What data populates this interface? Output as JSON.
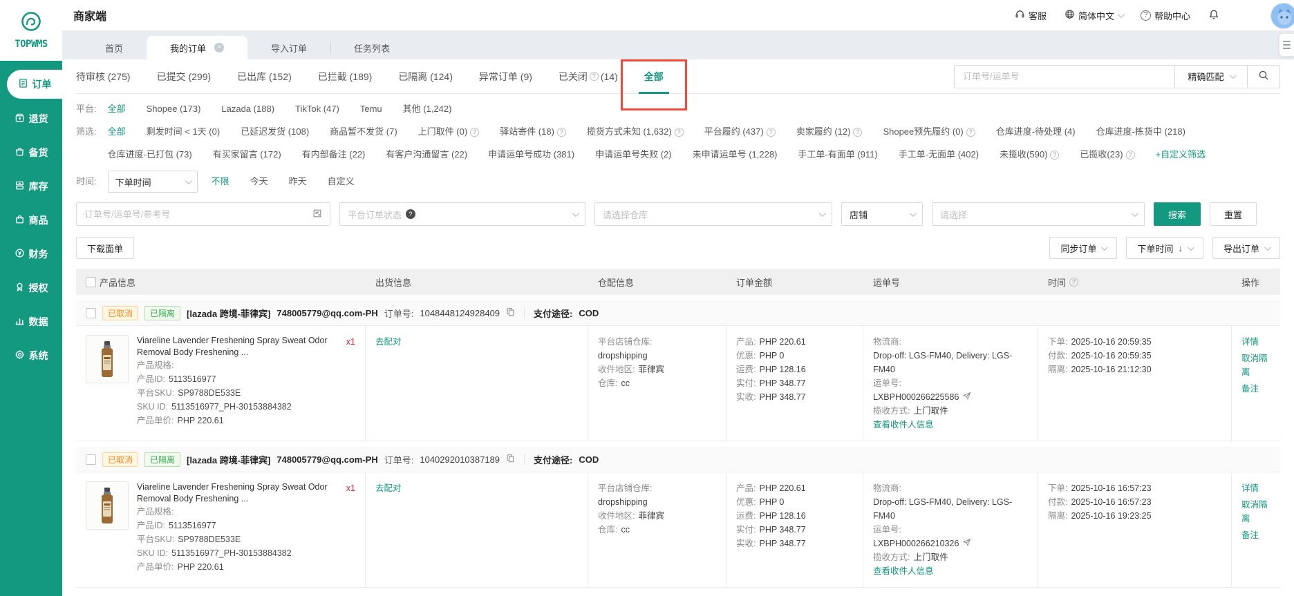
{
  "colors": {
    "accent": "#12997f",
    "annotation_red": "#f5483b",
    "cancel_badge_text": "#fa8c16",
    "quarantine_badge_text": "#3fae51"
  },
  "sidebar": {
    "logo_text": "TOPWMS",
    "items": [
      {
        "label": "订单",
        "active": true
      },
      {
        "label": "退货"
      },
      {
        "label": "备货"
      },
      {
        "label": "库存"
      },
      {
        "label": "商品"
      },
      {
        "label": "财务"
      },
      {
        "label": "授权"
      },
      {
        "label": "数据"
      },
      {
        "label": "系统"
      }
    ]
  },
  "topbar": {
    "title": "商家端",
    "customer_service": "客服",
    "language": "简体中文",
    "help_center": "帮助中心"
  },
  "tabs": {
    "home": "首页",
    "my_orders": "我的订单",
    "import_orders": "导入订单",
    "task_list": "任务列表"
  },
  "status_tabs": [
    {
      "t": "待审核 (275)"
    },
    {
      "t": "已提交 (299)"
    },
    {
      "t": "已出库 (152)"
    },
    {
      "t": "已拦截 (189)"
    },
    {
      "t": "已隔离 (124)"
    },
    {
      "t": "异常订单 (9)"
    },
    {
      "t": "已关闭",
      "help": true,
      "t2": "(14)"
    },
    {
      "t": "全部",
      "active": true,
      "boxed": true
    }
  ],
  "quick_search": {
    "placeholder": "订单号/运单号",
    "match_mode": "精确匹配"
  },
  "filters": {
    "platform_label": "平台:",
    "platform": [
      {
        "t": "全部",
        "active": true
      },
      {
        "t": "Shopee (173)"
      },
      {
        "t": "Lazada (188)"
      },
      {
        "t": "TikTok (47)"
      },
      {
        "t": "Temu"
      },
      {
        "t": "其他 (1,242)"
      }
    ],
    "screen_label": "筛选:",
    "screen_row1": [
      {
        "t": "全部",
        "active": true
      },
      {
        "t": "剩发时间 < 1天 (0)"
      },
      {
        "t": "已延迟发货 (108)"
      },
      {
        "t": "商品暂不发货 (7)"
      },
      {
        "t": "上门取件 (0)",
        "help": true
      },
      {
        "t": "驿站寄件 (18)",
        "help": true
      },
      {
        "t": "揽货方式未知 (1,632)",
        "help": true
      },
      {
        "t": "平台履约 (437)",
        "help": true
      },
      {
        "t": "卖家履约 (12)",
        "help": true
      },
      {
        "t": "Shopee预先履约 (0)",
        "help": true
      },
      {
        "t": "仓库进度-待处理 (4)"
      },
      {
        "t": "仓库进度-拣货中 (218)"
      }
    ],
    "screen_row2": [
      {
        "t": "仓库进度-已打包 (73)"
      },
      {
        "t": "有买家留言 (172)"
      },
      {
        "t": "有内部备注 (22)"
      },
      {
        "t": "有客户沟通留言 (22)"
      },
      {
        "t": "申请运单号成功 (381)"
      },
      {
        "t": "申请运单号失败 (2)"
      },
      {
        "t": "未申请运单号 (1,228)"
      },
      {
        "t": "手工单-有面单 (911)"
      },
      {
        "t": "手工单-无面单 (402)"
      },
      {
        "t": "未揽收(590)",
        "help": true
      },
      {
        "t": "已揽收(23)",
        "help": true
      },
      {
        "t": "+自定义筛选",
        "link": true
      }
    ],
    "time_label": "时间:",
    "time_select": "下单时间",
    "time_options": [
      {
        "t": "不限",
        "active": true
      },
      {
        "t": "今天"
      },
      {
        "t": "昨天"
      },
      {
        "t": "自定义"
      }
    ]
  },
  "search_bar": {
    "order_placeholder": "订单号/运单号/参考号",
    "status_placeholder": "平台订单状态",
    "warehouse_placeholder": "请选择仓库",
    "shop_value": "店铺",
    "select_placeholder": "请选择",
    "search": "搜索",
    "reset": "重置"
  },
  "toolbar": {
    "download": "下载面单",
    "sync": "同步订单",
    "sort": "下单时间",
    "export": "导出订单"
  },
  "table": {
    "headers": {
      "product": "产品信息",
      "shipping": "出货信息",
      "warehouse": "仓配信息",
      "amount": "订单金额",
      "tracking": "运单号",
      "time": "时间",
      "actions": "操作"
    }
  },
  "orders": [
    {
      "badge_cancelled": "已取消",
      "badge_quarantined": "已隔离",
      "shop_tag": "[lazada 跨境-菲律宾]",
      "account": "748005779@qq.com-PH",
      "order_no_label": "订单号:",
      "order_no": "1048448124928409",
      "payment_label": "支付途径:",
      "payment": "COD",
      "product": {
        "title": "Viareline  Lavender Freshening Spray Sweat Odor Removal Body Freshening ...",
        "qty": "x1",
        "spec_label": "产品规格:",
        "id_label": "产品ID:",
        "id": "5113516977",
        "sku_label": "平台SKU:",
        "sku": "SP9788DE533E",
        "skuid_label": "SKU ID:",
        "skuid": "5113516977_PH-30153884382",
        "price_label": "产品单价:",
        "price": "PHP 220.61"
      },
      "match_action": "去配对",
      "warehouse": {
        "store_label": "平台店铺仓库:",
        "store": "dropshipping",
        "region_label": "收件地区:",
        "region": "菲律宾",
        "wh_label": "仓库:",
        "wh": "cc"
      },
      "amounts": [
        {
          "label": "产品:",
          "value": "PHP 220.61"
        },
        {
          "label": "优惠:",
          "value": "PHP 0"
        },
        {
          "label": "运费:",
          "value": "PHP 128.16"
        },
        {
          "label": "实付:",
          "value": "PHP 348.77"
        },
        {
          "label": "实收:",
          "value": "PHP 348.77"
        }
      ],
      "tracking": {
        "carrier_label": "物流商:",
        "carrier": "Drop-off: LGS-FM40, Delivery: LGS-FM40",
        "no_label": "运单号:",
        "no": "LXBPH000266225586",
        "method_label": "揽收方式:",
        "method": "上门取件",
        "view_recipient": "查看收件人信息"
      },
      "times": [
        {
          "label": "下单:",
          "value": "2025-10-16 20:59:35"
        },
        {
          "label": "付款:",
          "value": "2025-10-16 20:59:35"
        },
        {
          "label": "隔离:",
          "value": "2025-10-16 21:12:30"
        }
      ],
      "actions": [
        "详情",
        "取消隔离",
        "备注"
      ]
    },
    {
      "badge_cancelled": "已取消",
      "badge_quarantined": "已隔离",
      "shop_tag": "[lazada 跨境-菲律宾]",
      "account": "748005779@qq.com-PH",
      "order_no_label": "订单号:",
      "order_no": "1040292010387189",
      "payment_label": "支付途径:",
      "payment": "COD",
      "product": {
        "title": "Viareline  Lavender Freshening Spray Sweat Odor Removal Body Freshening ...",
        "qty": "x1",
        "spec_label": "产品规格:",
        "id_label": "产品ID:",
        "id": "5113516977",
        "sku_label": "平台SKU:",
        "sku": "SP9788DE533E",
        "skuid_label": "SKU ID:",
        "skuid": "5113516977_PH-30153884382",
        "price_label": "产品单价:",
        "price": "PHP 220.61"
      },
      "match_action": "去配对",
      "warehouse": {
        "store_label": "平台店铺仓库:",
        "store": "dropshipping",
        "region_label": "收件地区:",
        "region": "菲律宾",
        "wh_label": "仓库:",
        "wh": "cc"
      },
      "amounts": [
        {
          "label": "产品:",
          "value": "PHP 220.61"
        },
        {
          "label": "优惠:",
          "value": "PHP 0"
        },
        {
          "label": "运费:",
          "value": "PHP 128.16"
        },
        {
          "label": "实付:",
          "value": "PHP 348.77"
        },
        {
          "label": "实收:",
          "value": "PHP 348.77"
        }
      ],
      "tracking": {
        "carrier_label": "物流商:",
        "carrier": "Drop-off: LGS-FM40, Delivery: LGS-FM40",
        "no_label": "运单号:",
        "no": "LXBPH000266210326",
        "method_label": "揽收方式:",
        "method": "上门取件",
        "view_recipient": "查看收件人信息"
      },
      "times": [
        {
          "label": "下单:",
          "value": "2025-10-16 16:57:23"
        },
        {
          "label": "付款:",
          "value": "2025-10-16 16:57:23"
        },
        {
          "label": "隔离:",
          "value": "2025-10-16 19:23:25"
        }
      ],
      "actions": [
        "详情",
        "取消隔离",
        "备注"
      ]
    }
  ]
}
